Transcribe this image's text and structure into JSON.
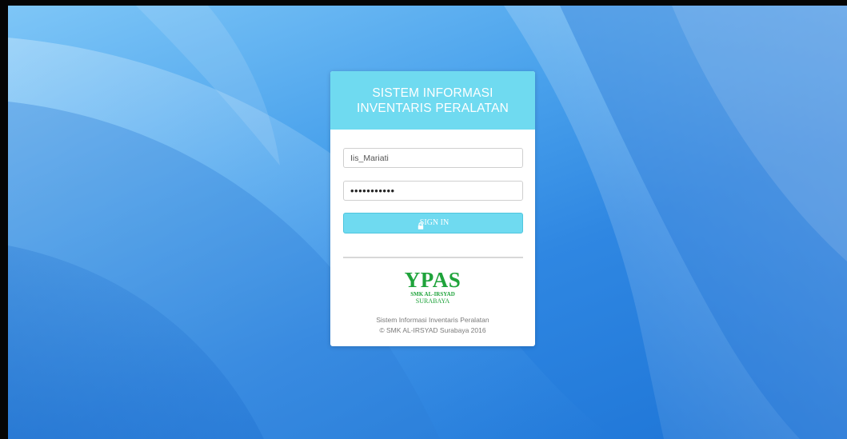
{
  "login": {
    "title_line1": "SISTEM INFORMASI",
    "title_line2": "INVENTARIS PERALATAN",
    "username_value": "Iis_Mariati",
    "password_value": "•••••••••••",
    "signin_label": "SIGN IN",
    "signin_icon": "lock-icon"
  },
  "logo": {
    "name": "YPAS",
    "line1": "SMK AL-IRSYAD",
    "line2": "SURABAYA",
    "color": "#1fa33b"
  },
  "footer": {
    "line1": "Sistem Informasi Inventaris Peralatan",
    "line2": "© SMK AL-IRSYAD Surabaya 2016"
  },
  "colors": {
    "accent": "#6fdaf0",
    "background": "#2f87e2"
  }
}
